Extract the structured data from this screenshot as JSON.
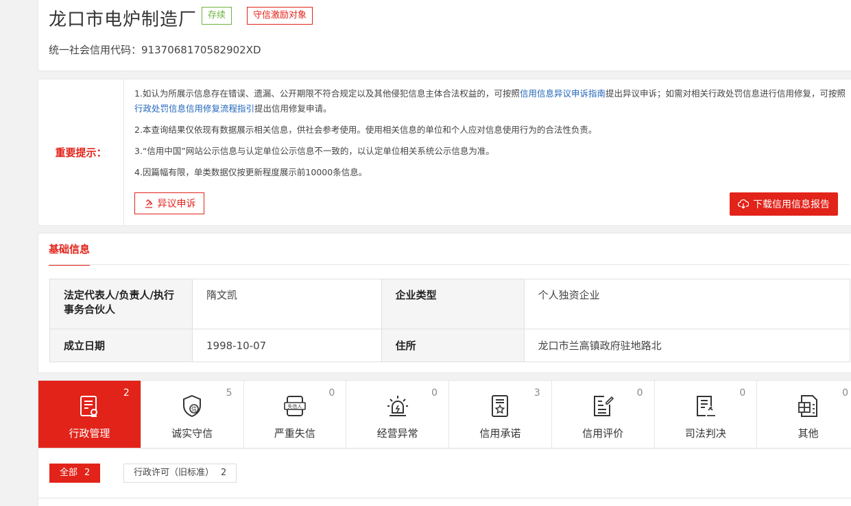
{
  "company": {
    "name": "龙口市电炉制造厂",
    "status_tag": "存续",
    "incentive_tag": "守信激励对象",
    "credit_code_label": "统一社会信用代码：",
    "credit_code": "9137068170582902XD"
  },
  "notice": {
    "label": "重要提示：",
    "p1_a": "1.如认为所展示信息存在错误、遗漏、公开期限不符合规定以及其他侵犯信息主体合法权益的，可按照",
    "p1_link1": "信用信息异议申诉指南",
    "p1_b": "提出异议申诉；如需对相关行政处罚信息进行信用修复，可按照",
    "p1_link2": "行政处罚信息信用修复流程指引",
    "p1_c": "提出信用修复申请。",
    "p2": "2.本查询结果仅依现有数据展示相关信息，供社会参考使用。使用相关信息的单位和个人应对信息使用行为的合法性负责。",
    "p3": "3.“信用中国”网站公示信息与认定单位公示信息不一致的，以认定单位相关系统公示信息为准。",
    "p4": "4.因篇幅有限，单类数据仅按更新程度展示前10000条信息。",
    "appeal_button": "异议申诉",
    "download_button": "下载信用信息报告"
  },
  "basic_info": {
    "title": "基础信息",
    "rows": [
      {
        "label1": "法定代表人/负责人/执行事务合伙人",
        "value1": "隋文凯",
        "label2": "企业类型",
        "value2": "个人独资企业"
      },
      {
        "label1": "成立日期",
        "value1": "1998-10-07",
        "label2": "住所",
        "value2": "龙口市兰高镇政府驻地路北"
      }
    ]
  },
  "tabs": [
    {
      "label": "行政管理",
      "count": "2",
      "icon": "admin-doc-icon",
      "active": true
    },
    {
      "label": "诚实守信",
      "count": "5",
      "icon": "shield-credit-icon",
      "active": false
    },
    {
      "label": "严重失信",
      "count": "0",
      "icon": "dishonest-person-icon",
      "active": false
    },
    {
      "label": "经营异常",
      "count": "0",
      "icon": "alarm-light-icon",
      "active": false
    },
    {
      "label": "信用承诺",
      "count": "3",
      "icon": "commitment-doc-icon",
      "active": false
    },
    {
      "label": "信用评价",
      "count": "0",
      "icon": "evaluation-doc-icon",
      "active": false
    },
    {
      "label": "司法判决",
      "count": "0",
      "icon": "judgment-doc-icon",
      "active": false
    },
    {
      "label": "其他",
      "count": "0",
      "icon": "other-grid-icon",
      "active": false
    }
  ],
  "filters": {
    "all_label": "全部",
    "all_count": "2",
    "sub_label": "行政许可（旧标准）",
    "sub_count": "2"
  },
  "colors": {
    "accent": "#e2231a",
    "status_green": "#6cb33e",
    "link": "#2266bb"
  }
}
